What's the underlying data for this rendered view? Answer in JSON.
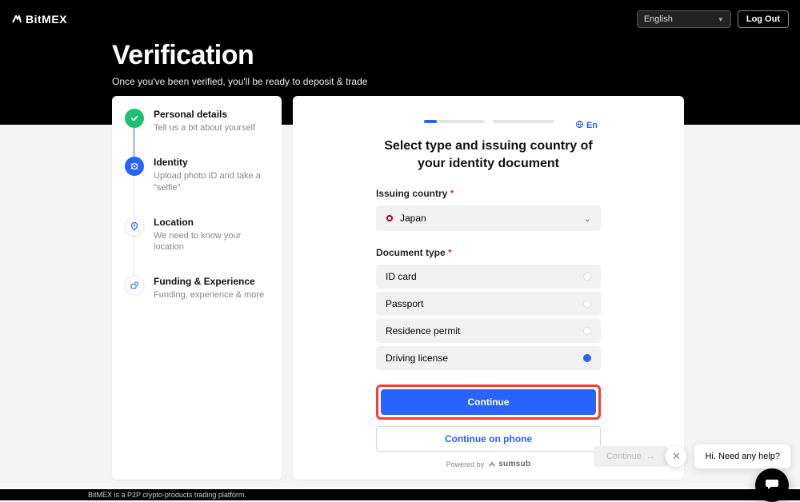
{
  "header": {
    "brand": "BitMEX",
    "language_selected": "English",
    "logout_label": "Log Out"
  },
  "page": {
    "title": "Verification",
    "subtitle": "Once you've been verified, you'll be ready to deposit & trade"
  },
  "steps": [
    {
      "name": "Personal details",
      "desc": "Tell us a bit about yourself",
      "state": "done"
    },
    {
      "name": "Identity",
      "desc": "Upload photo ID and take a \"selfie\"",
      "state": "current"
    },
    {
      "name": "Location",
      "desc": "We need to know your location",
      "state": "pending"
    },
    {
      "name": "Funding & Experience",
      "desc": "Funding, experience & more",
      "state": "pending"
    }
  ],
  "panel": {
    "lang_badge": "En",
    "title": "Select type and issuing country of your identity document",
    "issuing_country_label": "Issuing country",
    "country_selected": "Japan",
    "doc_type_label": "Document type",
    "doc_options": [
      {
        "label": "ID card",
        "selected": false
      },
      {
        "label": "Passport",
        "selected": false
      },
      {
        "label": "Residence permit",
        "selected": false
      },
      {
        "label": "Driving license",
        "selected": true
      }
    ],
    "continue_label": "Continue",
    "phone_label": "Continue on phone",
    "powered_by": "Powered by",
    "provider": "sumsub",
    "disabled_continue": "Continue"
  },
  "help": {
    "message": "Hi. Need any help?"
  },
  "footer": {
    "text": "BitMEX is a P2P crypto-products trading platform."
  }
}
